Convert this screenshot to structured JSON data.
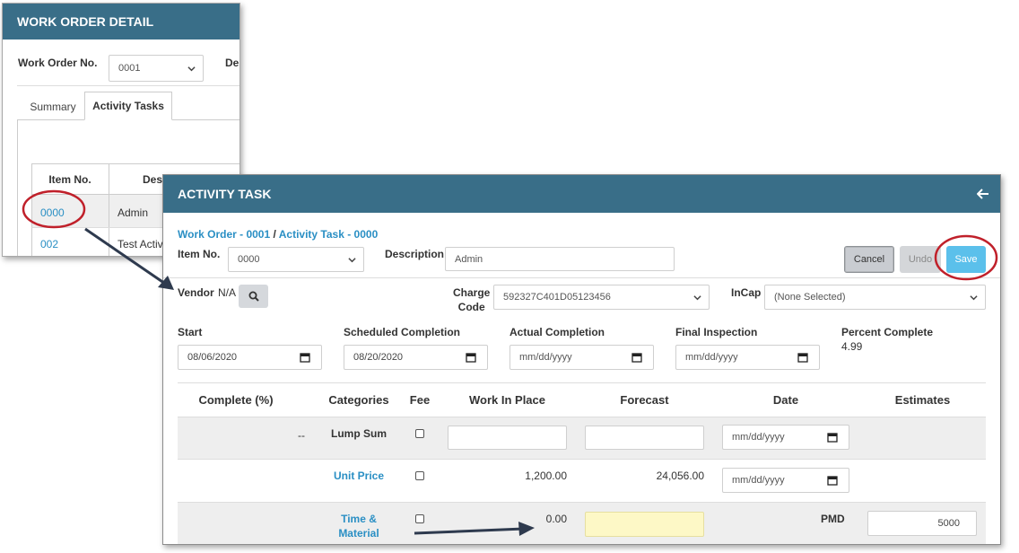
{
  "work_order_window": {
    "title": "WORK ORDER DETAIL",
    "work_order_label": "Work Order No.",
    "work_order_value": "0001",
    "description_label_partial": "Des",
    "tabs": [
      {
        "label": "Summary"
      },
      {
        "label": "Activity Tasks"
      }
    ],
    "table": {
      "headers": [
        "Item No.",
        "Desc"
      ],
      "rows": [
        {
          "item": "0000",
          "desc": "Admin"
        },
        {
          "item": "002",
          "desc": "Test Activi"
        }
      ]
    }
  },
  "activity_window": {
    "title": "ACTIVITY TASK",
    "back_icon": "arrow-left-icon",
    "breadcrumb": {
      "work_order": "Work Order - 0001",
      "separator": "/",
      "activity_task": "Activity Task - 0000"
    },
    "item_no_label": "Item No.",
    "item_no_value": "0000",
    "description_label": "Description",
    "description_value": "Admin",
    "buttons": {
      "cancel": "Cancel",
      "undo": "Undo",
      "save": "Save"
    },
    "vendor_label": "Vendor",
    "vendor_value": "N/A",
    "search_icon": "search-icon",
    "charge_code_label_1": "Charge",
    "charge_code_label_2": "Code",
    "charge_code_value": "592327C401D05123456",
    "incap_label": "InCap",
    "incap_value": "(None Selected)",
    "dates": {
      "start_label": "Start",
      "start_value": "08/06/2020",
      "scheduled_label": "Scheduled Completion",
      "scheduled_value": "08/20/2020",
      "actual_label": "Actual Completion",
      "actual_placeholder": "mm/dd/yyyy",
      "final_label": "Final Inspection",
      "final_placeholder": "mm/dd/yyyy",
      "percent_label": "Percent Complete",
      "percent_value": "4.99"
    },
    "grid": {
      "headers": [
        "Complete (%)",
        "Categories",
        "Fee",
        "Work In Place",
        "Forecast",
        "Date",
        "Estimates"
      ],
      "rows": [
        {
          "complete": "--",
          "category": "Lump Sum",
          "wip": "",
          "forecast": "",
          "date_placeholder": "mm/dd/yyyy"
        },
        {
          "complete": "",
          "category": "Unit Price",
          "wip": "1,200.00",
          "forecast": "24,056.00",
          "date_placeholder": "mm/dd/yyyy"
        },
        {
          "complete": "",
          "category_line1": "Time &",
          "category_line2": "Material",
          "wip": "0.00",
          "pmd_label": "PMD",
          "estimate": "5000"
        }
      ]
    }
  },
  "colors": {
    "header": "#396e88",
    "link": "#2a8fc4",
    "save": "#5bc0eb",
    "annotation": "#c0202a",
    "highlight": "#fdf8c6"
  }
}
